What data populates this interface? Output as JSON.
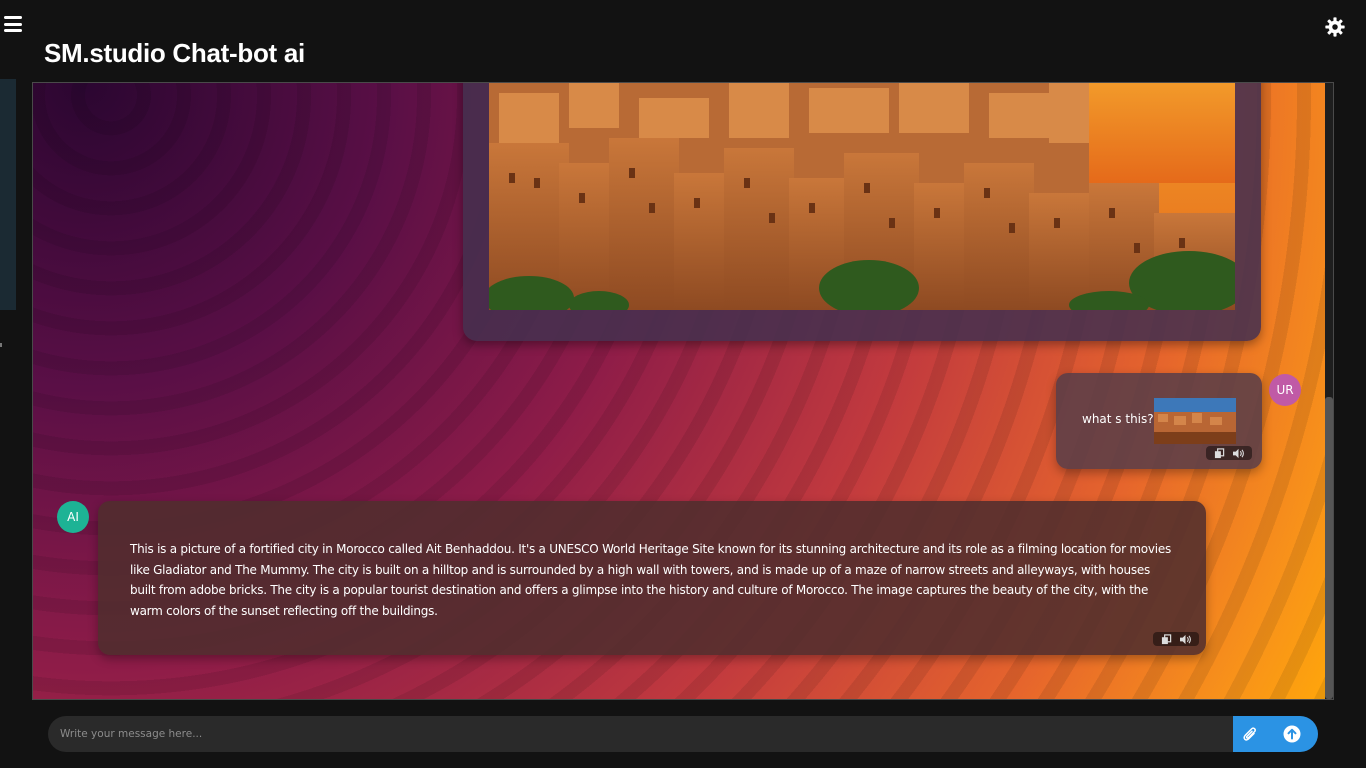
{
  "header": {
    "title": "SM.studio Chat-bot ai"
  },
  "icons": {
    "menu": "hamburger-menu-icon",
    "settings": "gear-icon",
    "copy": "copy-icon",
    "speak": "speaker-icon",
    "attach": "paperclip-icon",
    "send": "arrow-up-circle-icon"
  },
  "messages": {
    "user": {
      "avatar": "UR",
      "text": "what s this?"
    },
    "ai": {
      "avatar": "AI",
      "text": "This is a picture of a fortified city in Morocco called Ait Benhaddou. It's a UNESCO World Heritage Site known for its stunning architecture and its role as a filming location for movies like Gladiator and The Mummy. The city is built on a hilltop and is surrounded by a high wall with towers, and is made up of a maze of narrow streets and alleyways, with houses built from adobe bricks. The city is a popular tourist destination and offers a glimpse into the history and culture of Morocco. The image captures the beauty of the city, with the warm colors of the sunset reflecting off the buildings."
    }
  },
  "composer": {
    "placeholder": "Write your message here..."
  },
  "colors": {
    "accent": "#2b93e4",
    "user_avatar": "#c05aa6",
    "ai_avatar": "#1db395",
    "background": "#121212"
  }
}
